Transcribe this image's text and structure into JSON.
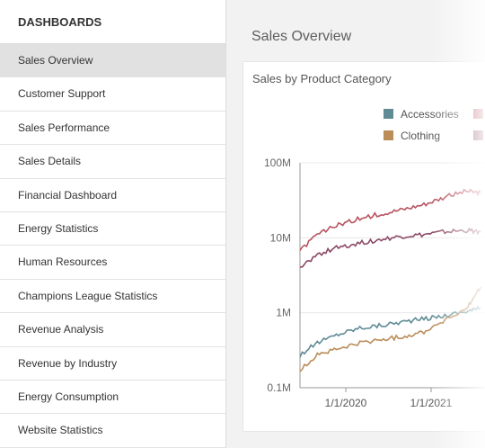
{
  "sidebar": {
    "title": "DASHBOARDS",
    "items": [
      {
        "label": "Sales Overview",
        "selected": true
      },
      {
        "label": "Customer Support"
      },
      {
        "label": "Sales Performance"
      },
      {
        "label": "Sales Details"
      },
      {
        "label": "Financial Dashboard"
      },
      {
        "label": "Energy Statistics"
      },
      {
        "label": "Human Resources"
      },
      {
        "label": "Champions League Statistics"
      },
      {
        "label": "Revenue Analysis"
      },
      {
        "label": "Revenue by Industry"
      },
      {
        "label": "Energy Consumption"
      },
      {
        "label": "Website Statistics"
      }
    ]
  },
  "main": {
    "title": "Sales Overview",
    "card_title": "Sales by Product Category"
  },
  "chart_data": {
    "type": "line",
    "title": "Sales by Product Category",
    "y_scale": "log",
    "ylim": [
      100000,
      100000000
    ],
    "y_ticks": [
      "100M",
      "10M",
      "1M",
      "0.1M"
    ],
    "x_ticks": [
      "1/1/2020",
      "1/1/2021"
    ],
    "legend_placement": "top-right",
    "series": [
      {
        "name": "Accessories",
        "color": "#5f8b95",
        "x": [
          "2019-06-01",
          "2019-09-01",
          "2019-12-01",
          "2020-03-01",
          "2020-06-01",
          "2020-09-01",
          "2020-12-01",
          "2021-03-01",
          "2021-06-01",
          "2021-08-01"
        ],
        "values": [
          250000,
          400000,
          520000,
          630000,
          680000,
          760000,
          830000,
          920000,
          1050000,
          1150000
        ]
      },
      {
        "name": "Clothing",
        "color": "#ba8d59",
        "x": [
          "2019-06-01",
          "2019-09-01",
          "2019-12-01",
          "2020-03-01",
          "2020-06-01",
          "2020-09-01",
          "2020-12-01",
          "2021-03-01",
          "2021-06-01",
          "2021-08-01"
        ],
        "values": [
          150000,
          280000,
          330000,
          390000,
          440000,
          480000,
          560000,
          800000,
          1100000,
          2200000
        ]
      },
      {
        "name": "",
        "color": "#b8535f",
        "x": [
          "2019-06-01",
          "2019-09-01",
          "2019-12-01",
          "2020-03-01",
          "2020-06-01",
          "2020-09-01",
          "2020-12-01",
          "2021-03-01",
          "2021-06-01",
          "2021-08-01"
        ],
        "values": [
          6000000,
          11000000,
          15000000,
          18000000,
          21000000,
          24000000,
          28000000,
          35000000,
          42000000,
          40000000
        ]
      },
      {
        "name": "",
        "color": "#8c4a66",
        "x": [
          "2019-06-01",
          "2019-09-01",
          "2019-12-01",
          "2020-03-01",
          "2020-06-01",
          "2020-09-01",
          "2020-12-01",
          "2021-03-01",
          "2021-06-01",
          "2021-08-01"
        ],
        "values": [
          3500000,
          6000000,
          7500000,
          8500000,
          9500000,
          10500000,
          11000000,
          12000000,
          12500000,
          12000000
        ]
      }
    ]
  }
}
